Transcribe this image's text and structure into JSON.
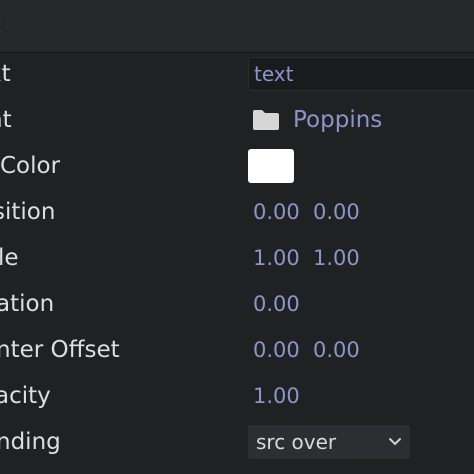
{
  "header": {
    "title": "t"
  },
  "rows": [
    {
      "label": "xt",
      "value": "text"
    },
    {
      "label": "nt",
      "value": "Poppins",
      "icon": "folder-icon"
    },
    {
      "label": "Color",
      "value_color": "#ffffff"
    },
    {
      "label": "sition",
      "value_x": "0.00",
      "value_y": "0.00"
    },
    {
      "label": "le",
      "value_x": "1.00",
      "value_y": "1.00"
    },
    {
      "label": "ation",
      "value": "0.00"
    },
    {
      "label": "nter Offset",
      "value_x": "0.00",
      "value_y": "0.00"
    },
    {
      "label": "acity",
      "value": "1.00"
    },
    {
      "label": "nding",
      "value": "src over",
      "icon": "chevron-down-icon"
    }
  ],
  "colors": {
    "background": "#202123",
    "header": "#262729",
    "label_text": "#dedede",
    "value_text": "#8c95c9",
    "field_bg": "#1a1b1d",
    "select_bg": "#2d2e31"
  }
}
